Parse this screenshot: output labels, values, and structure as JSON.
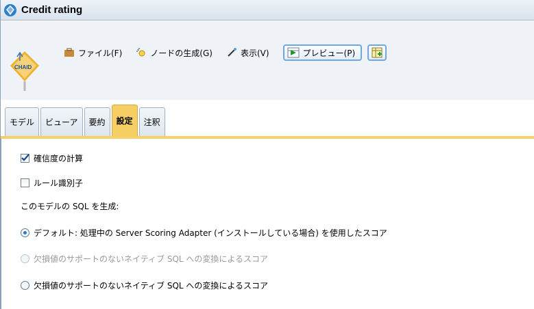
{
  "window": {
    "title": "Credit rating"
  },
  "node": {
    "badge": "CHAID"
  },
  "menubar": {
    "file": "ファイル(F)",
    "generate": "ノードの生成(G)",
    "view": "表示(V)",
    "preview": "プレビュー(P)"
  },
  "tabs": [
    {
      "label": "モデル"
    },
    {
      "label": "ビューア"
    },
    {
      "label": "要約"
    },
    {
      "label": "設定",
      "active": true
    },
    {
      "label": "注釈"
    }
  ],
  "settings": {
    "calc_confidence": {
      "label": "確信度の計算",
      "checked": true
    },
    "rule_id": {
      "label": "ルール識別子",
      "checked": false
    },
    "sql_heading": "このモデルの SQL を生成:",
    "options": [
      {
        "label": "デフォルト: 処理中の Server Scoring Adapter (インストールしている場合) を使用したスコア",
        "selected": true,
        "enabled": true
      },
      {
        "label": "欠損値のサポートのないネイティブ SQL への変換によるスコア",
        "selected": false,
        "enabled": false
      },
      {
        "label": "欠損値のサポートのないネイティブ SQL への変換によるスコア",
        "selected": false,
        "enabled": true
      }
    ]
  },
  "colors": {
    "active_tab": "#f6d064",
    "accent": "#2a79c8"
  }
}
